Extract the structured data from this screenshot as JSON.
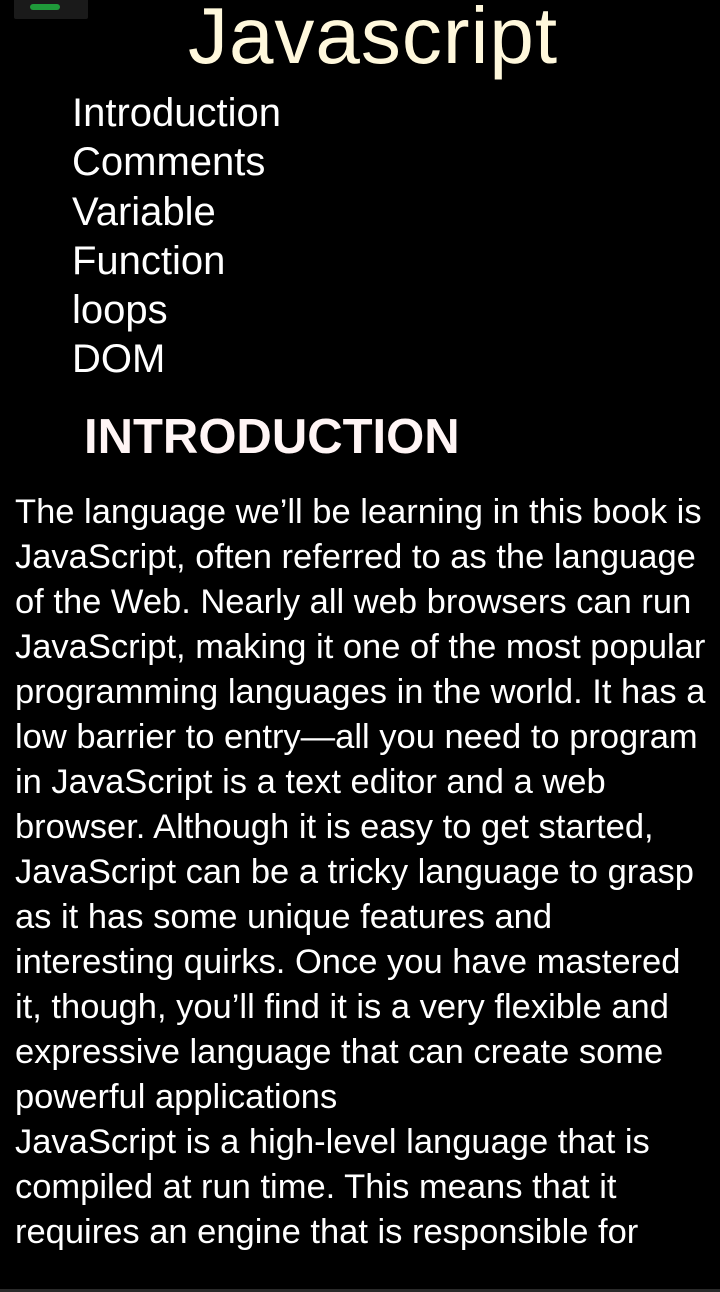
{
  "header": {
    "title": "Javascript"
  },
  "toc": {
    "items": [
      {
        "label": "Introduction"
      },
      {
        "label": "Comments"
      },
      {
        "label": "Variable"
      },
      {
        "label": "Function"
      },
      {
        "label": "loops"
      },
      {
        "label": "DOM"
      }
    ]
  },
  "section": {
    "heading": "INTRODUCTION",
    "paragraphs": [
      "The language we’ll be learning in this book is JavaScript, often referred to as the language of the Web. Nearly all web browsers can run JavaScript, making it one of the most popular programming languages in the world. It has a low barrier to entry—all you need to program in JavaScript is a text editor and a web browser. Although it is easy to get started, JavaScript can be a tricky language to grasp as it has some unique features and interesting quirks. Once you have mastered it, though, you’ll find it is a very flexible and expressive language that can create some powerful applications",
      "JavaScript is a high-level language that is compiled at run time. This means that it requires an engine that is responsible for"
    ]
  },
  "colors": {
    "background": "#000000",
    "title": "#fff8dc",
    "text": "#ffffff",
    "menu_accent": "#1f9a3a"
  },
  "icons": {
    "menu": "menu-icon"
  }
}
